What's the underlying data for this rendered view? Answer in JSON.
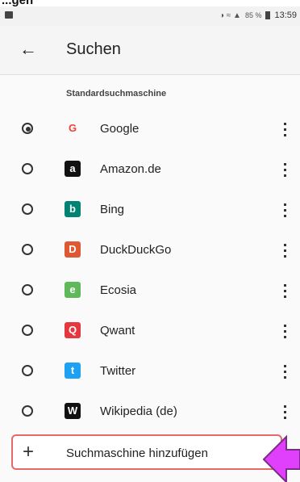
{
  "top_cut_text": "...gen",
  "status": {
    "battery": "85 %",
    "time": "13:59"
  },
  "appbar": {
    "back_label": "←",
    "title": "Suchen"
  },
  "section_header": "Standardsuchmaschine",
  "engines": [
    {
      "name": "Google",
      "selected": true,
      "icon": "google-icon",
      "color": "#ea4335",
      "glyph": "G"
    },
    {
      "name": "Amazon.de",
      "selected": false,
      "icon": "amazon-icon",
      "color": "#111111",
      "glyph": "a"
    },
    {
      "name": "Bing",
      "selected": false,
      "icon": "bing-icon",
      "color": "#008373",
      "glyph": "b"
    },
    {
      "name": "DuckDuckGo",
      "selected": false,
      "icon": "duckduckgo-icon",
      "color": "#de5833",
      "glyph": "D"
    },
    {
      "name": "Ecosia",
      "selected": false,
      "icon": "ecosia-icon",
      "color": "#5fb85a",
      "glyph": "e"
    },
    {
      "name": "Qwant",
      "selected": false,
      "icon": "qwant-icon",
      "color": "#e4373e",
      "glyph": "Q"
    },
    {
      "name": "Twitter",
      "selected": false,
      "icon": "twitter-icon",
      "color": "#1da1f2",
      "glyph": "t"
    },
    {
      "name": "Wikipedia (de)",
      "selected": false,
      "icon": "wikipedia-icon",
      "color": "#111111",
      "glyph": "W"
    }
  ],
  "add_engine": {
    "plus": "+",
    "label": "Suchmaschine hinzufügen"
  },
  "highlight_color": "#e46a6a",
  "pointer_color": "#e040fb"
}
